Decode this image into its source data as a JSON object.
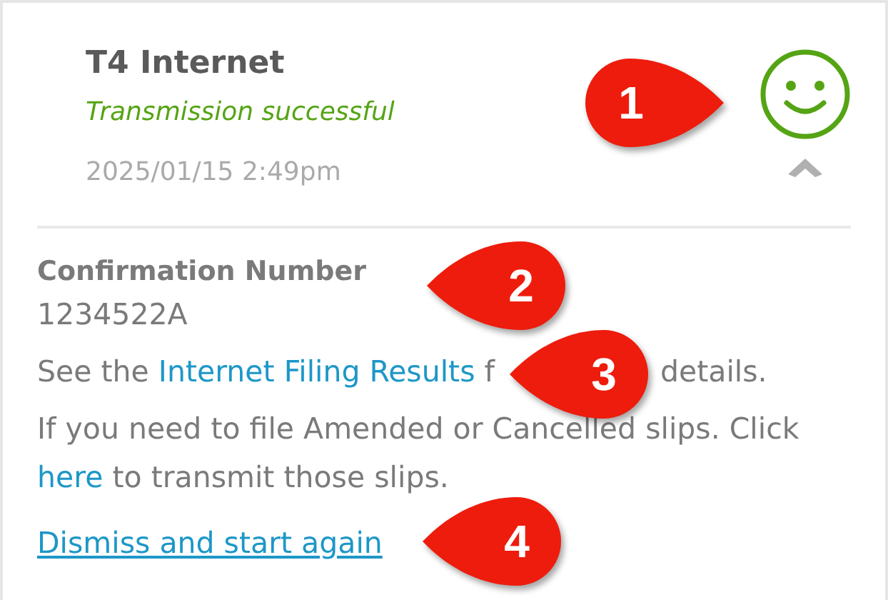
{
  "result": {
    "title": "T4 Internet",
    "status": "Transmission successful",
    "kind": "success",
    "timestamp": "2025/01/15 2:49pm",
    "expanded": true
  },
  "confirmation": {
    "label": "Confirmation Number",
    "number": "1234522A"
  },
  "details_line": {
    "before": "See the ",
    "link": "Internet Filing Results",
    "after": "f",
    "tail": "details."
  },
  "amend_line": {
    "before": "If you need to file Amended or Cancelled slips. Click ",
    "link": "here",
    "after": " to transmit those slips."
  },
  "dismiss_link": "Dismiss and start again",
  "callouts": [
    {
      "number": "1",
      "kind": "right"
    },
    {
      "number": "2",
      "kind": "left"
    },
    {
      "number": "3",
      "kind": "left"
    },
    {
      "number": "4",
      "kind": "left"
    }
  ]
}
